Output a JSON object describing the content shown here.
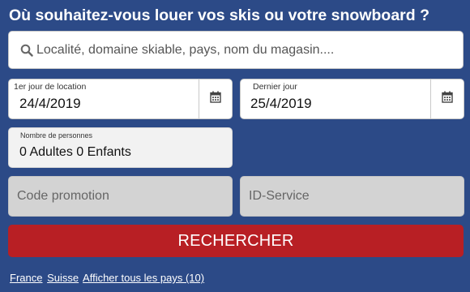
{
  "title": "Où souhaitez-vous louer vos skis ou votre snowboard ?",
  "search": {
    "placeholder": "Localité, domaine skiable, pays, nom du magasin....",
    "icon": "search-icon"
  },
  "dates": {
    "start": {
      "label": "1er jour de location",
      "value": "24/4/2019",
      "icon": "calendar-icon"
    },
    "end": {
      "label": "Dernier jour",
      "value": "25/4/2019",
      "icon": "calendar-icon"
    }
  },
  "persons": {
    "label": "Nombre de personnes",
    "value": "0 Adultes 0 Enfants"
  },
  "promo": {
    "placeholder": "Code promotion"
  },
  "service": {
    "placeholder": "ID-Service"
  },
  "submit_label": "RECHERCHER",
  "links": [
    "France",
    "Suisse",
    "Afficher tous les pays (10)"
  ],
  "colors": {
    "background": "#2c4a87",
    "button": "#b81f24",
    "disabled_field": "#d3d3d3"
  }
}
